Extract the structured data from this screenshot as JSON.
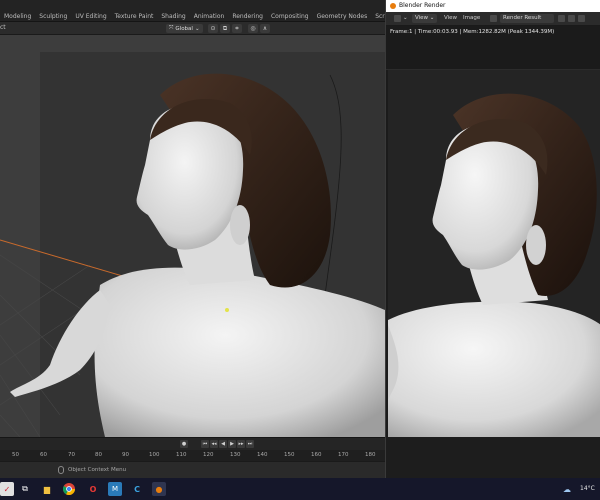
{
  "topbar": {
    "tabs": [
      "Modeling",
      "Sculpting",
      "UV Editing",
      "Texture Paint",
      "Shading",
      "Animation",
      "Rendering",
      "Compositing",
      "Geometry Nodes",
      "Scripting"
    ],
    "add_label": "+"
  },
  "viewport_header": {
    "mode_label": "ct",
    "orientation": "Global"
  },
  "timeline": {
    "ticks": [
      "50",
      "60",
      "70",
      "80",
      "90",
      "100",
      "110",
      "120",
      "130",
      "140",
      "150",
      "160",
      "170",
      "180"
    ]
  },
  "statusbar": {
    "message": "Object Context Menu"
  },
  "render_window": {
    "title": "Blender Render",
    "menu_view": "View",
    "menu_view2": "View",
    "menu_image": "Image",
    "image_name": "Render Result",
    "frame_info": "Frame:1 | Time:00:03.93 | Mem:1282.82M (Peak 1344.39M)"
  },
  "taskbar": {
    "temperature": "14°C"
  },
  "colors": {
    "accent": "#e87d0d",
    "taskbar": "#15172a",
    "viewport_bg": "#3d3d3d"
  }
}
